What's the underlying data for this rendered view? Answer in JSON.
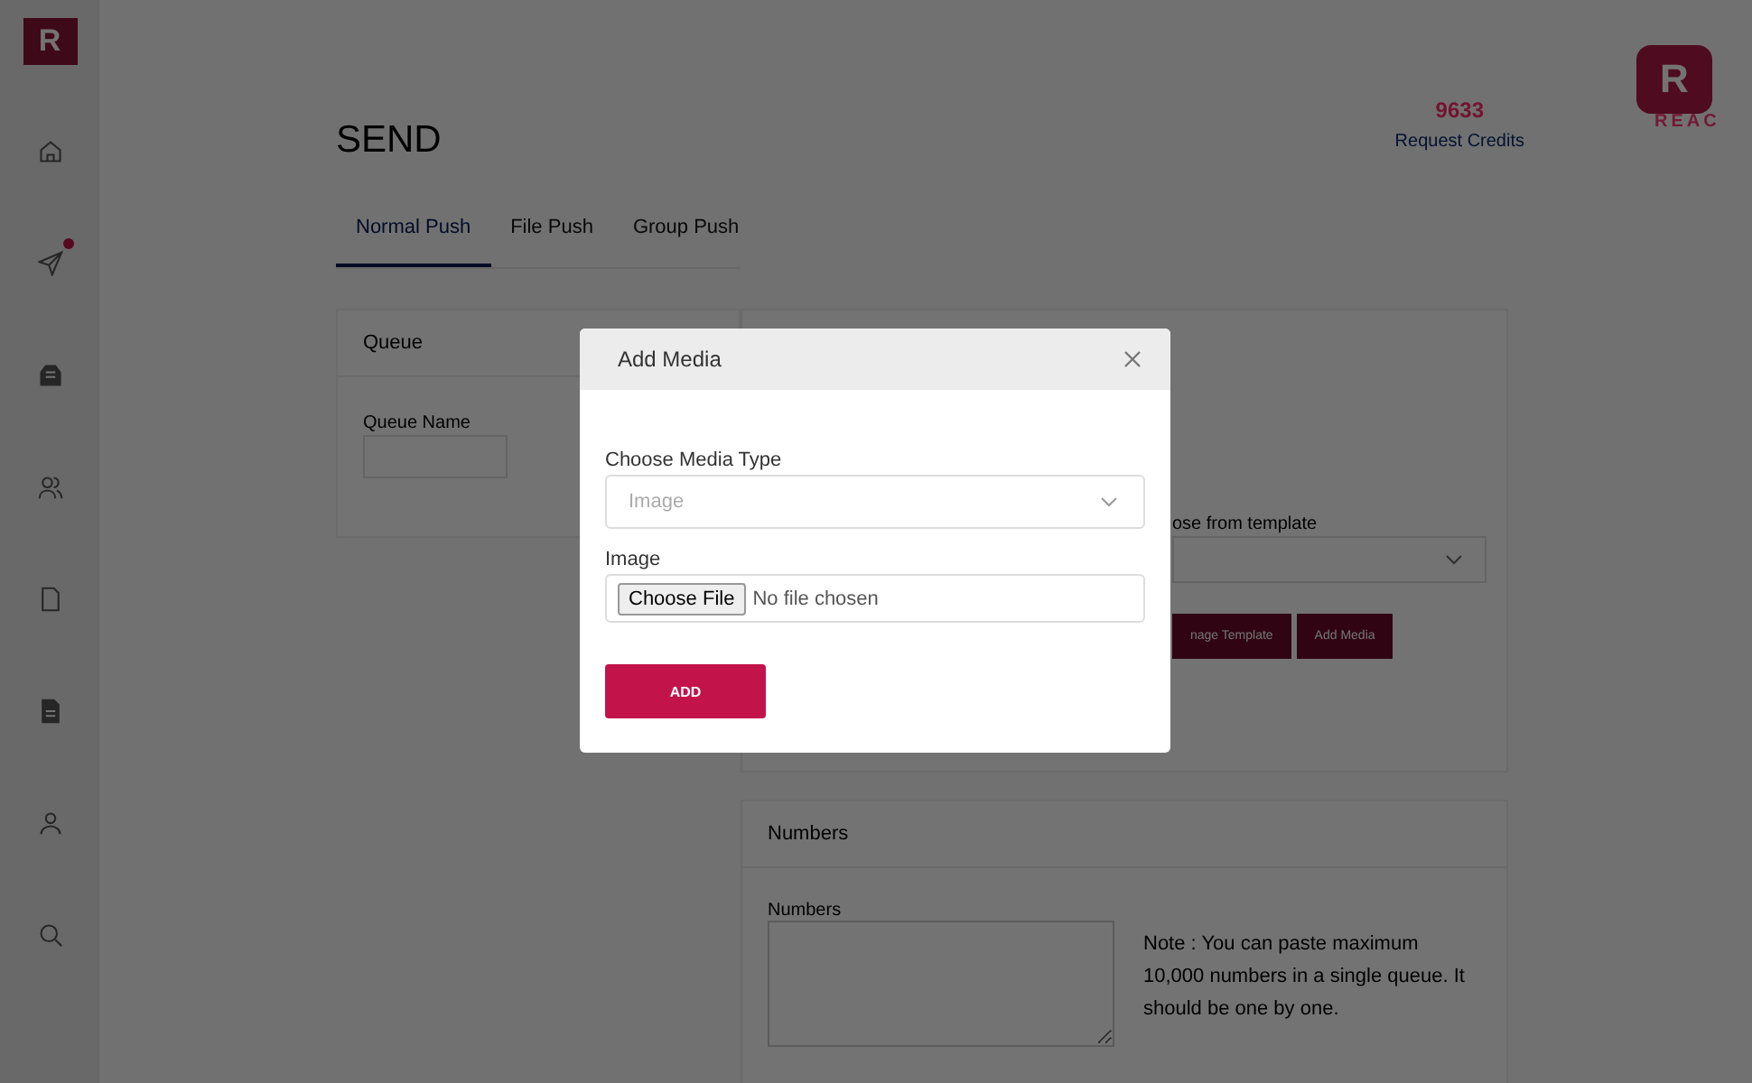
{
  "sidebar": {
    "items": [
      {
        "kind": "home",
        "notification": false
      },
      {
        "kind": "send",
        "notification": true
      },
      {
        "kind": "inbox",
        "notification": false
      },
      {
        "kind": "users",
        "notification": false
      },
      {
        "kind": "file",
        "notification": false
      },
      {
        "kind": "document",
        "notification": false
      },
      {
        "kind": "user",
        "notification": false
      },
      {
        "kind": "search",
        "notification": false
      }
    ]
  },
  "logo_letter": "R",
  "header": {
    "logo_letter": "R",
    "title": "SEND",
    "credits": "9633",
    "credits_link": "Request Credits",
    "brand_text": "REAC"
  },
  "tabs": [
    {
      "label": "Normal Push",
      "selected": true
    },
    {
      "label": "File Push",
      "selected": false
    },
    {
      "label": "Group Push",
      "selected": false
    }
  ],
  "queue_card": {
    "title": "Queue",
    "field_label": "Queue Name"
  },
  "template_card": {
    "label": "ose from template",
    "buttons": [
      "nage Template",
      "Add Media"
    ]
  },
  "numbers_card": {
    "title": "Numbers",
    "field_label": "Numbers",
    "note": "Note : You can paste maximum 10,000 numbers in a single queue. It should be one by one."
  },
  "modal": {
    "title": "Add Media",
    "type_label": "Choose Media Type",
    "type_placeholder": "Image",
    "file_label": "Image",
    "file_button": "Choose File",
    "file_status": "No file chosen",
    "submit": "ADD"
  }
}
